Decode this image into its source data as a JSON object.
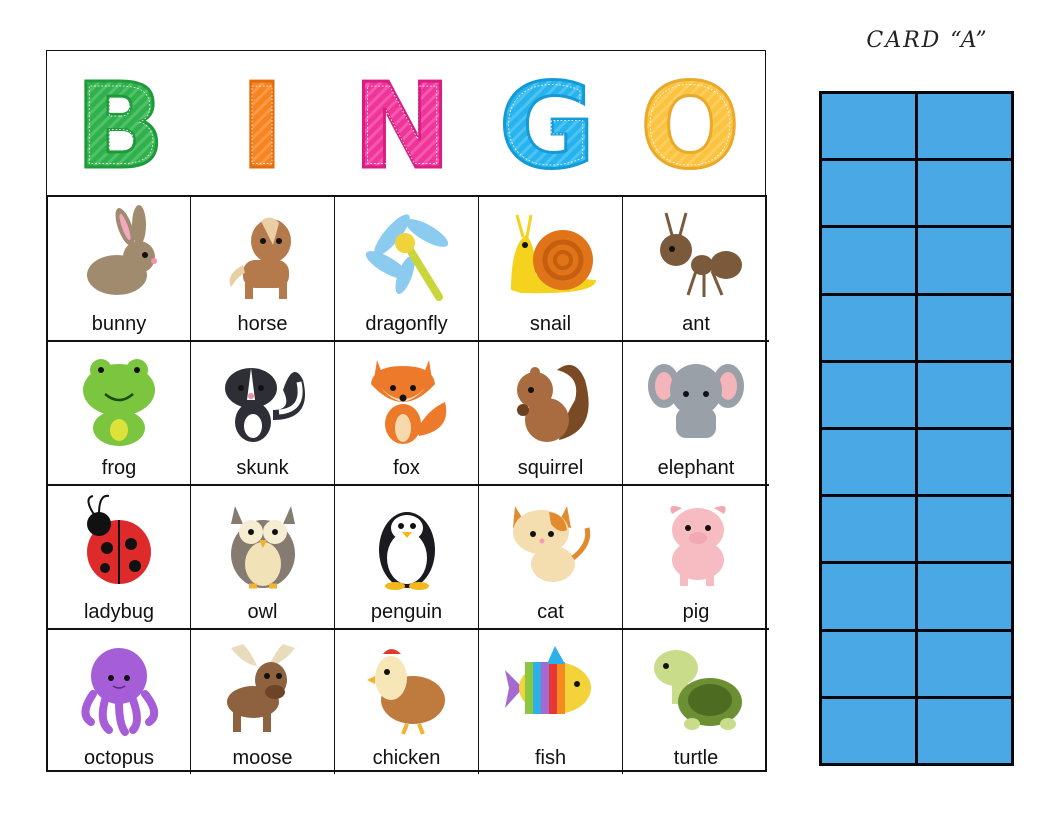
{
  "card": {
    "title": "CARD “A”",
    "header_letters": [
      {
        "letter": "B",
        "color": "#2fb24c",
        "stroke": "#1f9a3a"
      },
      {
        "letter": "I",
        "color": "#f7841f",
        "stroke": "#e56c0c"
      },
      {
        "letter": "N",
        "color": "#f0359a",
        "stroke": "#d81d83"
      },
      {
        "letter": "G",
        "color": "#27b4ee",
        "stroke": "#149ad6"
      },
      {
        "letter": "O",
        "color": "#fbc33e",
        "stroke": "#eaa92a"
      }
    ],
    "rows": [
      [
        {
          "label": "bunny",
          "icon": "bunny-icon",
          "color": "#a08b6e"
        },
        {
          "label": "horse",
          "icon": "horse-icon",
          "color": "#b47a4c"
        },
        {
          "label": "dragonfly",
          "icon": "dragonfly-icon",
          "color": "#8ccbf0"
        },
        {
          "label": "snail",
          "icon": "snail-icon",
          "color": "#e07418"
        },
        {
          "label": "ant",
          "icon": "ant-icon",
          "color": "#7a5a3a"
        }
      ],
      [
        {
          "label": "frog",
          "icon": "frog-icon",
          "color": "#7cc53e"
        },
        {
          "label": "skunk",
          "icon": "skunk-icon",
          "color": "#2e2f36"
        },
        {
          "label": "fox",
          "icon": "fox-icon",
          "color": "#ec7a2a"
        },
        {
          "label": "squirrel",
          "icon": "squirrel-icon",
          "color": "#a86c40"
        },
        {
          "label": "elephant",
          "icon": "elephant-icon",
          "color": "#9aa0a8"
        }
      ],
      [
        {
          "label": "ladybug",
          "icon": "ladybug-icon",
          "color": "#de2a2a"
        },
        {
          "label": "owl",
          "icon": "owl-icon",
          "color": "#857b70"
        },
        {
          "label": "penguin",
          "icon": "penguin-icon",
          "color": "#1b1b1f"
        },
        {
          "label": "cat",
          "icon": "cat-icon",
          "color": "#f4ddae"
        },
        {
          "label": "pig",
          "icon": "pig-icon",
          "color": "#f6bcc2"
        }
      ],
      [
        {
          "label": "octopus",
          "icon": "octopus-icon",
          "color": "#a65ed8"
        },
        {
          "label": "moose",
          "icon": "moose-icon",
          "color": "#8e623e"
        },
        {
          "label": "chicken",
          "icon": "chicken-icon",
          "color": "#bf7a3e"
        },
        {
          "label": "fish",
          "icon": "fish-icon",
          "color": "#f4d23a"
        },
        {
          "label": "turtle",
          "icon": "turtle-icon",
          "color": "#6c8f34"
        }
      ]
    ]
  },
  "score_sheet": {
    "rows": 10,
    "columns": 2,
    "fill_color": "#4aa8e4",
    "line_color": "#05070d"
  }
}
